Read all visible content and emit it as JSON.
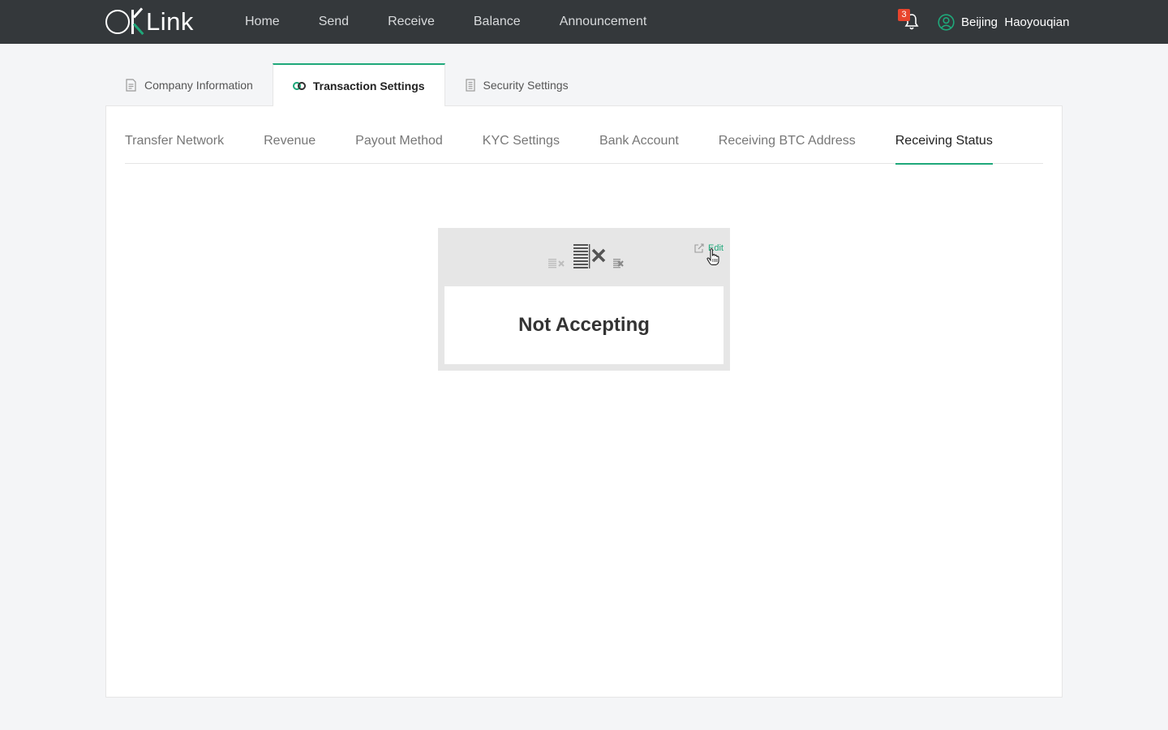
{
  "brand": {
    "logo_text": "Link",
    "accent_color": "#1fa87a",
    "topbar_color": "#34383b"
  },
  "nav": {
    "items": [
      {
        "label": "Home"
      },
      {
        "label": "Send"
      },
      {
        "label": "Receive"
      },
      {
        "label": "Balance"
      },
      {
        "label": "Announcement"
      }
    ]
  },
  "header": {
    "notifications": {
      "icon": "bell-icon",
      "count": "3",
      "badge_color": "#e8452d"
    },
    "user": {
      "icon": "user-icon",
      "name": "Beijing  Haoyouqian"
    }
  },
  "primary_tabs": [
    {
      "label": "Company Information",
      "icon": "document-icon",
      "active": false
    },
    {
      "label": "Transaction Settings",
      "icon": "link-icon",
      "active": true
    },
    {
      "label": "Security Settings",
      "icon": "security-doc-icon",
      "active": false
    }
  ],
  "secondary_tabs": [
    {
      "label": "Transfer Network",
      "active": false
    },
    {
      "label": "Revenue",
      "active": false
    },
    {
      "label": "Payout Method",
      "active": false
    },
    {
      "label": "KYC Settings",
      "active": false
    },
    {
      "label": "Bank Account",
      "active": false
    },
    {
      "label": "Receiving BTC Address",
      "active": false
    },
    {
      "label": "Receiving Status",
      "active": true
    }
  ],
  "status_card": {
    "edit_label": "Edit",
    "edit_icon": "edit-icon",
    "status_icon": "not-accepting-icon",
    "status_text": "Not Accepting"
  }
}
